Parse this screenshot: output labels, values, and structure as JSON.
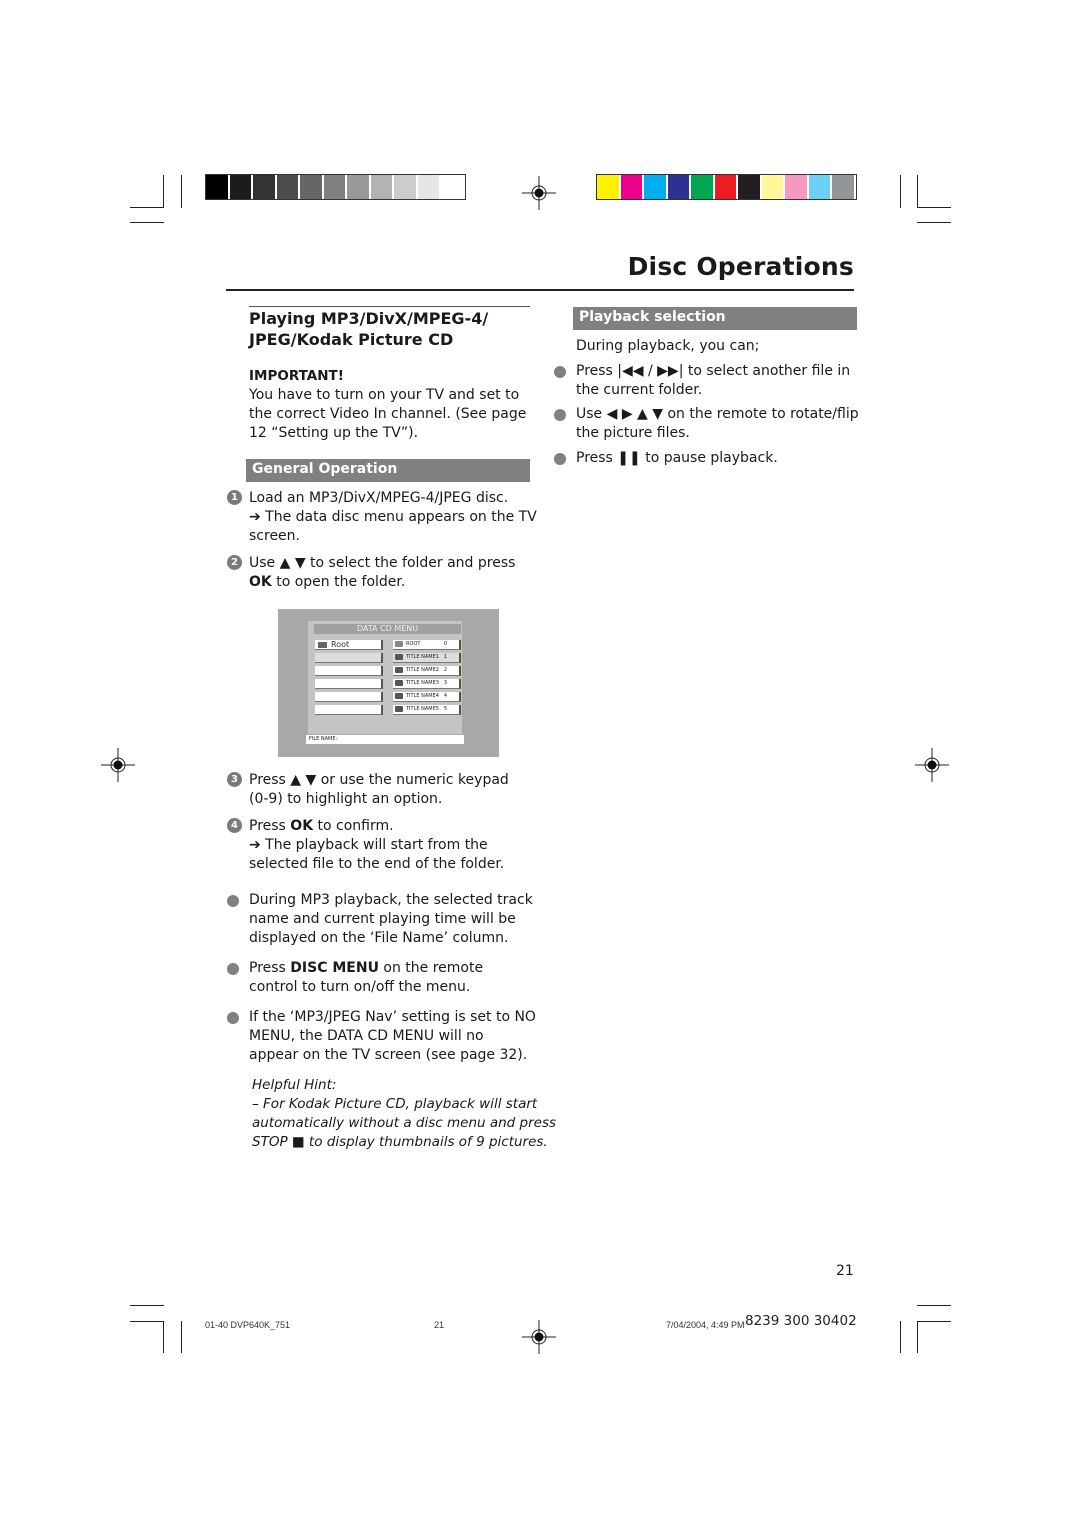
{
  "print_marks": {
    "grayscale_swatches": [
      "#000000",
      "#1c1c1c",
      "#333333",
      "#4d4d4d",
      "#666666",
      "#808080",
      "#999999",
      "#b3b3b3",
      "#cccccc",
      "#e6e6e6",
      "#ffffff"
    ],
    "color_swatches": [
      "#fff200",
      "#ec008c",
      "#00aeef",
      "#2e3192",
      "#00a651",
      "#ed1c24",
      "#231f20",
      "#fff799",
      "#f49ac1",
      "#6dcff6",
      "#939598"
    ]
  },
  "header": {
    "title": "Disc Operations"
  },
  "left": {
    "heading": "Playing MP3/DivX/MPEG-4/ JPEG/Kodak Picture CD",
    "heading_line1": "Playing MP3/DivX/MPEG-4/",
    "heading_line2": "JPEG/Kodak Picture CD",
    "important_label": "IMPORTANT!",
    "important_lines": [
      "You have to turn on your TV and set to",
      "the correct Video In channel.  (See page",
      "12 “Setting up the TV”)."
    ],
    "general_operation_header": "General Operation",
    "steps": [
      {
        "num": "1",
        "lines": [
          "Load an MP3/DivX/MPEG-4/JPEG disc.",
          "➔ The data disc menu appears on the TV",
          "screen."
        ]
      },
      {
        "num": "2",
        "line1_pre": "Use ▲ ▼ to select the folder and press",
        "line2_bold": "OK",
        "line2_rest": " to open the folder."
      },
      {
        "num": "3",
        "lines": [
          "Press ▲ ▼ or use the numeric keypad",
          "(0-9) to highlight an option."
        ]
      },
      {
        "num": "4",
        "line1_pre": "Press ",
        "line1_bold": "OK",
        "line1_rest": " to confirm.",
        "lines": [
          "➔ The playback will start from the",
          "selected file to the end of the folder."
        ]
      }
    ],
    "bullets": [
      {
        "lines": [
          "During MP3 playback, the selected track",
          "name and current playing time will be",
          "displayed on the ‘File Name’ column."
        ]
      },
      {
        "line1_pre": "Press ",
        "line1_bold": "DISC MENU",
        "line1_rest": " on the remote",
        "lines": [
          "control to turn on/off the menu."
        ]
      },
      {
        "lines": [
          "If the ‘MP3/JPEG Nav’ setting is set to NO",
          "MENU, the DATA CD MENU will no",
          "appear on the TV screen (see page 32)."
        ]
      }
    ],
    "hint": {
      "title": "Helpful Hint:",
      "lines": [
        "–    For Kodak Picture CD, playback will start",
        "automatically without a disc menu and press",
        "STOP ■ to display thumbnails of 9 pictures."
      ]
    }
  },
  "tv_menu": {
    "title": "DATA CD MENU",
    "left_items": [
      "Root",
      "",
      "",
      "",
      "",
      ""
    ],
    "right_items": [
      {
        "label": "ROOT",
        "num": "0"
      },
      {
        "label": "TITLE NAME1",
        "num": "1"
      },
      {
        "label": "TITLE NAME2",
        "num": "2"
      },
      {
        "label": "TITLE NAME3",
        "num": "3"
      },
      {
        "label": "TITLE NAME4",
        "num": "4"
      },
      {
        "label": "TITLE NAME5",
        "num": "5"
      }
    ],
    "file_name_label": "FILE NAME:"
  },
  "right": {
    "playback_header": "Playback selection",
    "intro": "During playback, you can;",
    "bullets": [
      {
        "lines": [
          "Press |◀◀ / ▶▶| to select another file in",
          "the current folder."
        ]
      },
      {
        "lines": [
          "Use ◀ ▶ ▲ ▼ on the remote to rotate/flip",
          "the picture files."
        ]
      },
      {
        "lines": [
          "Press ❚❚ to pause playback."
        ]
      }
    ]
  },
  "page_number": "21",
  "footer": {
    "file_id": "01-40 DVP640K_751",
    "page": "21",
    "datetime": "7/04/2004, 4:49 PM",
    "code": "8239 300 30402"
  }
}
